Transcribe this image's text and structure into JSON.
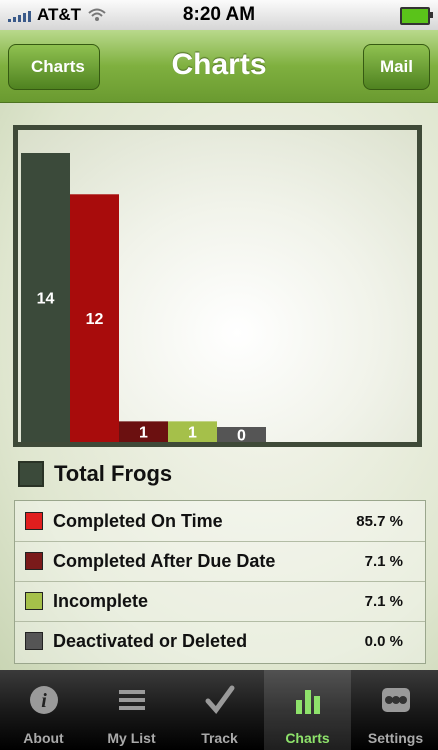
{
  "status_bar": {
    "carrier": "AT&T",
    "time": "8:20 AM"
  },
  "nav": {
    "title": "Charts",
    "back_label": "Charts",
    "right_label": "Mail"
  },
  "colors": {
    "total": "#3b4a3a",
    "on_time": "#a80c0c",
    "after_due": "#6b1010",
    "incomplete": "#a5c04a",
    "deleted": "#555555",
    "nav_green": "#7fb03f"
  },
  "chart_data": {
    "type": "bar",
    "categories": [
      "Total Frogs",
      "Completed On Time",
      "Completed After Due Date",
      "Incomplete",
      "Deactivated or Deleted"
    ],
    "values": [
      14,
      12,
      1,
      1,
      0
    ],
    "labels": [
      "14",
      "12",
      "1",
      "1",
      "0"
    ],
    "ylim": [
      0,
      14
    ],
    "grid": false
  },
  "legend": {
    "title": "Total Frogs"
  },
  "stats": [
    {
      "label": "Completed On Time",
      "pct": "85.7 %",
      "color": "#e01e1e"
    },
    {
      "label": "Completed After Due Date",
      "pct": "7.1 %",
      "color": "#7a1a1a"
    },
    {
      "label": "Incomplete",
      "pct": "7.1 %",
      "color": "#a5c04a"
    },
    {
      "label": "Deactivated or Deleted",
      "pct": "0.0 %",
      "color": "#555555"
    }
  ],
  "tabs": [
    {
      "label": "About",
      "icon": "info-icon"
    },
    {
      "label": "My List",
      "icon": "list-icon"
    },
    {
      "label": "Track",
      "icon": "checkmark-icon"
    },
    {
      "label": "Charts",
      "icon": "bar-chart-icon",
      "active": true
    },
    {
      "label": "Settings",
      "icon": "settings-icon"
    }
  ]
}
